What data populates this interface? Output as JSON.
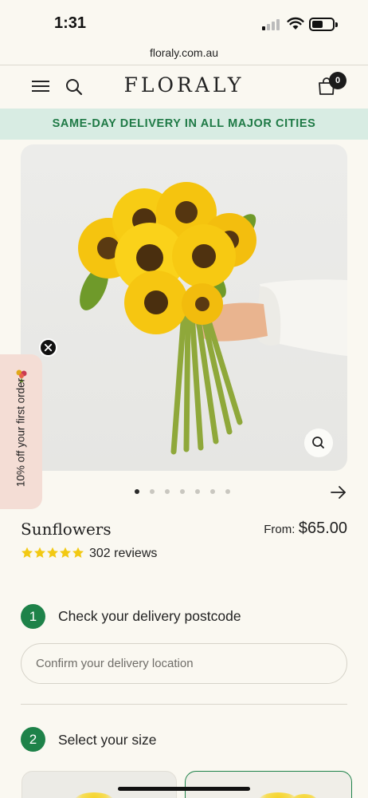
{
  "status_bar": {
    "time": "1:31"
  },
  "browser": {
    "url": "floraly.com.au"
  },
  "header": {
    "logo": "FLORALY",
    "cart_count": "0"
  },
  "promo_banner": {
    "text": "SAME-DAY DELIVERY IN ALL MAJOR CITIES"
  },
  "discount_tab": {
    "text": "10% off your first order"
  },
  "gallery": {
    "total_images": 7,
    "active_index": 0
  },
  "product": {
    "name": "Sunflowers",
    "price_prefix": "From:",
    "price": "$65.00",
    "rating": 5,
    "reviews": "302 reviews"
  },
  "steps": [
    {
      "number": "1",
      "label": "Check your delivery postcode",
      "input_placeholder": "Confirm your delivery location"
    },
    {
      "number": "2",
      "label": "Select your size"
    }
  ],
  "colors": {
    "background": "#faf8f1",
    "brand_green": "#1e8249",
    "promo_bg": "#d8ece3",
    "star_yellow": "#f2c913",
    "discount_tab_bg": "#f4ddd5"
  },
  "icons": [
    "menu-icon",
    "search-icon",
    "shopping-bag-icon",
    "zoom-icon",
    "close-icon",
    "arrow-right-icon",
    "star-icon",
    "signal-icon",
    "wifi-icon",
    "battery-icon"
  ]
}
